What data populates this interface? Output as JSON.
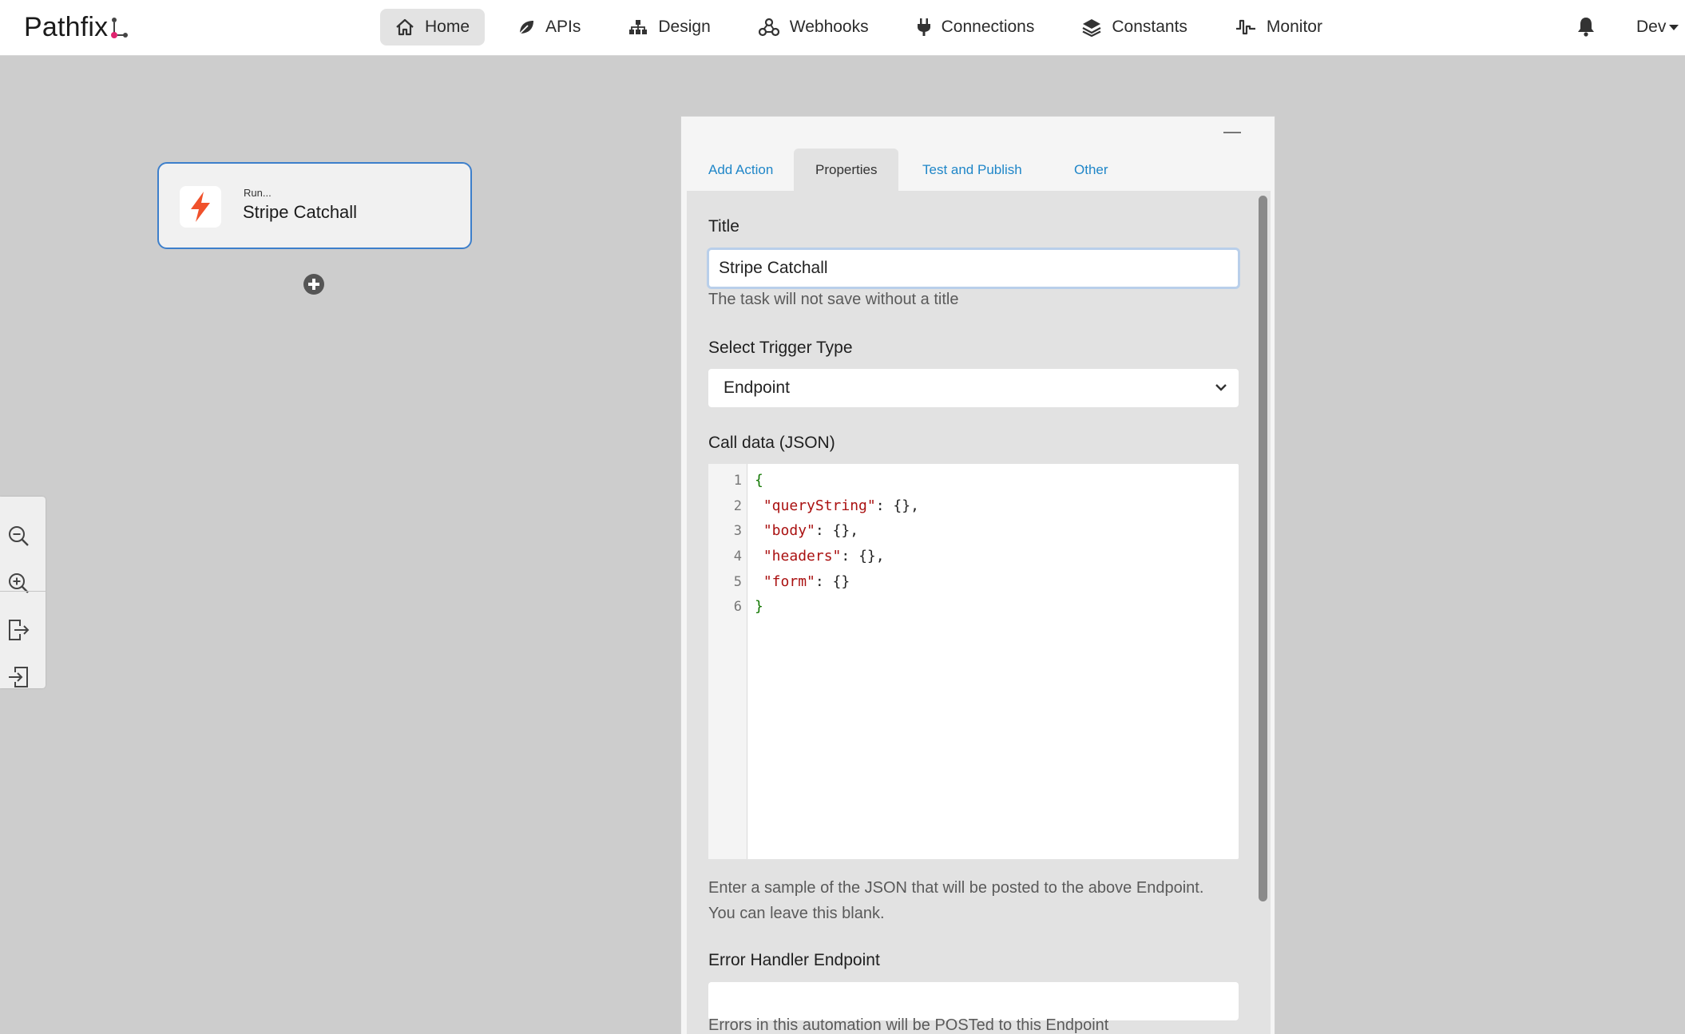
{
  "app": {
    "name": "Pathfix"
  },
  "nav": {
    "items": [
      {
        "label": "Home",
        "icon": "home-icon",
        "active": true
      },
      {
        "label": "APIs",
        "icon": "leaf-icon",
        "active": false
      },
      {
        "label": "Design",
        "icon": "sitemap-icon",
        "active": false
      },
      {
        "label": "Webhooks",
        "icon": "webhooks-icon",
        "active": false
      },
      {
        "label": "Connections",
        "icon": "plug-icon",
        "active": false
      },
      {
        "label": "Constants",
        "icon": "layers-icon",
        "active": false
      },
      {
        "label": "Monitor",
        "icon": "pulse-icon",
        "active": false
      }
    ],
    "user_label": "Dev"
  },
  "canvas": {
    "node": {
      "subtitle": "Run...",
      "title": "Stripe Catchall",
      "icon": "bolt-icon"
    }
  },
  "panel": {
    "tabs": [
      {
        "label": "Add Action",
        "active": false
      },
      {
        "label": "Properties",
        "active": true
      },
      {
        "label": "Test and Publish",
        "active": false
      },
      {
        "label": "Other",
        "active": false
      }
    ],
    "title_field": {
      "label": "Title",
      "value": "Stripe Catchall",
      "help": "The task will not save without a title"
    },
    "trigger_field": {
      "label": "Select Trigger Type",
      "selected": "Endpoint"
    },
    "call_data": {
      "label": "Call data (JSON)",
      "line_numbers": [
        "1",
        "2",
        "3",
        "4",
        "5",
        "6"
      ],
      "help_line1": "Enter a sample of the JSON that will be posted to the above Endpoint.",
      "help_line2": "You can leave this blank."
    },
    "error_handler": {
      "label": "Error Handler Endpoint",
      "value": "",
      "help": "Errors in this automation will be POSTed to this Endpoint"
    }
  },
  "colors": {
    "accent_blue": "#1f86c8",
    "node_border": "#3d7fcb",
    "bolt": "#f0512b",
    "logo_pink": "#e0246f"
  }
}
